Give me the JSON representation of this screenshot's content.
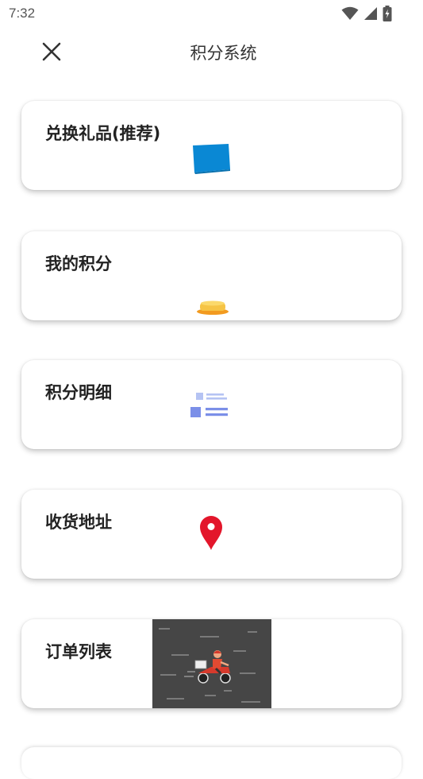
{
  "status_bar": {
    "time": "7:32",
    "icons": [
      "wifi-icon",
      "signal-icon",
      "battery-charging-icon"
    ]
  },
  "header": {
    "title": "积分系统",
    "close_icon": "close-icon"
  },
  "cards": [
    {
      "label": "兑换礼品(推荐)",
      "icon": "gift-card-icon"
    },
    {
      "label": "我的积分",
      "icon": "coins-icon"
    },
    {
      "label": "积分明细",
      "icon": "list-details-icon"
    },
    {
      "label": "收货地址",
      "icon": "location-pin-icon"
    },
    {
      "label": "订单列表",
      "icon": "delivery-scooter-illustration"
    }
  ],
  "colors": {
    "card_bg": "#ffffff",
    "gift_blue": "#0a88d4",
    "coin_yellow": "#f6c445",
    "coin_orange": "#f29a1f",
    "list_blue": "#7b8fe8",
    "list_light": "#b5c3f3",
    "pin_red": "#e3162b",
    "delivery_bg": "#464646"
  }
}
